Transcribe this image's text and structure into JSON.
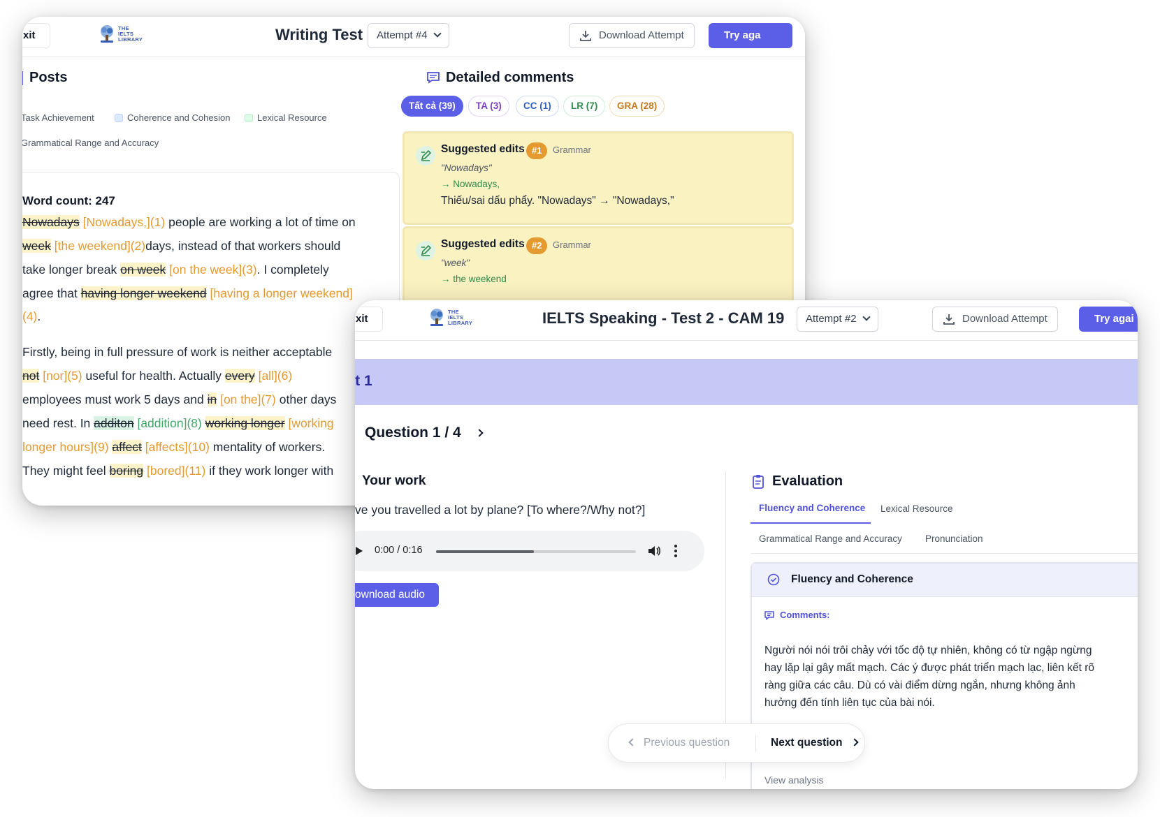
{
  "writing": {
    "exit": "xit",
    "logo": [
      "THE",
      "IELTS",
      "LIBRARY"
    ],
    "title": "Writing Test",
    "attempt": "Attempt #4",
    "download": "Download Attempt",
    "try": "Try aga",
    "posts_title": "Posts",
    "legend": [
      "Task Achievement",
      "Coherence and Cohesion",
      "Lexical Resource",
      "Grammatical Range and Accuracy"
    ],
    "word_count": "Word count: 247",
    "essay": [
      [
        {
          "t": "Nowadays",
          "k": "del"
        },
        {
          "t": " "
        },
        {
          "t": "[Nowadays,](1)",
          "k": "ins"
        },
        {
          "t": " people are working a lot of time on"
        }
      ],
      [
        {
          "t": "week",
          "k": "del"
        },
        {
          "t": " "
        },
        {
          "t": "[the weekend](2)",
          "k": "ins"
        },
        {
          "t": "days, instead of that workers should"
        }
      ],
      [
        {
          "t": "take longer break "
        },
        {
          "t": "on week",
          "k": "del"
        },
        {
          "t": " "
        },
        {
          "t": "[on the week](3)",
          "k": "ins"
        },
        {
          "t": ". I completely"
        }
      ],
      [
        {
          "t": "agree that "
        },
        {
          "t": "having longer weekend",
          "k": "del"
        },
        {
          "t": " "
        },
        {
          "t": "[having a longer weekend]",
          "k": "ins"
        }
      ],
      [
        {
          "t": "(4)",
          "k": "ins"
        },
        {
          "t": "."
        }
      ],
      [
        {
          "t": "Firstly, being in full pressure of work is neither acceptable"
        }
      ],
      [
        {
          "t": "not",
          "k": "del"
        },
        {
          "t": " "
        },
        {
          "t": "[nor](5)",
          "k": "ins"
        },
        {
          "t": " useful for health. Actually "
        },
        {
          "t": "every",
          "k": "del"
        },
        {
          "t": " "
        },
        {
          "t": "[all](6)",
          "k": "ins"
        }
      ],
      [
        {
          "t": "employees must work 5 days and "
        },
        {
          "t": "in",
          "k": "del"
        },
        {
          "t": " "
        },
        {
          "t": "[on the](7)",
          "k": "ins"
        },
        {
          "t": " other days"
        }
      ],
      [
        {
          "t": "need rest. In "
        },
        {
          "t": "additon",
          "k": "delg"
        },
        {
          "t": " "
        },
        {
          "t": "[addition](8)",
          "k": "insg"
        },
        {
          "t": " "
        },
        {
          "t": "working longer",
          "k": "del"
        },
        {
          "t": " "
        },
        {
          "t": "[working",
          "k": "ins"
        }
      ],
      [
        {
          "t": "longer hours](9)",
          "k": "ins"
        },
        {
          "t": " "
        },
        {
          "t": "affect",
          "k": "del"
        },
        {
          "t": " "
        },
        {
          "t": "[affects](10)",
          "k": "ins"
        },
        {
          "t": " mentality of workers."
        }
      ],
      [
        {
          "t": "They might feel "
        },
        {
          "t": "boring",
          "k": "del"
        },
        {
          "t": " "
        },
        {
          "t": "[bored](11)",
          "k": "ins"
        },
        {
          "t": " if they work longer with"
        }
      ]
    ],
    "comments_title": "Detailed comments",
    "chips": [
      "Tất cả (39)",
      "TA (3)",
      "CC (1)",
      "LR (7)",
      "GRA (28)"
    ],
    "edits": [
      {
        "label": "Suggested edits",
        "num": "#1",
        "cat": "Grammar",
        "orig": "\"Nowadays\"",
        "fix": "→ Nowadays,",
        "expl": "Thiếu/sai dấu phẩy. \"Nowadays\" → \"Nowadays,\""
      },
      {
        "label": "Suggested edits",
        "num": "#2",
        "cat": "Grammar",
        "orig": "\"week\"",
        "fix": "→ the weekend",
        "expl": ""
      }
    ]
  },
  "speaking": {
    "exit": "xit",
    "logo": [
      "THE",
      "IELTS",
      "LIBRARY"
    ],
    "title": "IELTS Speaking - Test 2 - CAM 19",
    "attempt": "Attempt #2",
    "download": "Download Attempt",
    "try": "Try agai",
    "part": "rt 1",
    "question": "Question 1 / 4",
    "your_work": "Your work",
    "question_text": "ve you travelled a lot by plane? [To where?/Why not?]",
    "audio_time": "0:00 / 0:16",
    "audio_progress": 0.49,
    "download_audio": "ownload audio",
    "evaluation_title": "Evaluation",
    "tabs": [
      "Fluency and Coherence",
      "Lexical Resource",
      "Grammatical Range and Accuracy",
      "Pronunciation"
    ],
    "card_title": "Fluency and Coherence",
    "comments_label": "Comments:",
    "comments_text": "Người nói nói trôi chảy với tốc độ tự nhiên, không có từ ngập ngừng hay lặp lại gây mất mạch. Các ý được phát triển mạch lạc, liên kết rõ ràng giữa các câu. Dù có vài điểm dừng ngắn, nhưng không ảnh hưởng đến tính liên tục của bài nói.",
    "view_analysis": "View analysis",
    "prev": "Previous question",
    "next": "Next question"
  },
  "colors": {
    "accent": "#5b5ee6",
    "insert": "#e59a2f",
    "insert_green": "#43a86a",
    "card": "#fbf2c2"
  }
}
